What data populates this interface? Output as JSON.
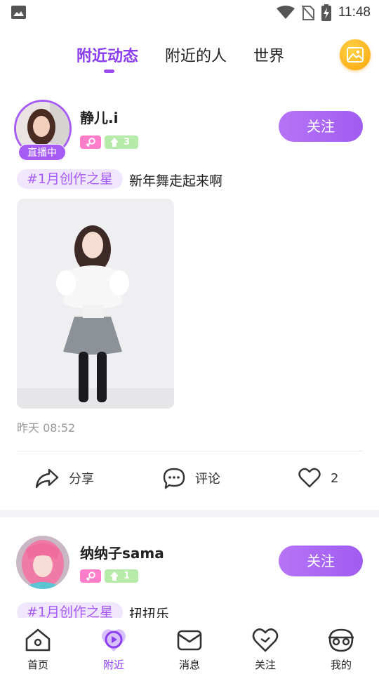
{
  "status_bar": {
    "time": "11:48",
    "icons": [
      "image-icon",
      "wifi-icon",
      "no-sim-icon",
      "battery-charging-icon"
    ]
  },
  "top_tabs": {
    "items": [
      {
        "label": "附近动态",
        "active": true
      },
      {
        "label": "附近的人",
        "active": false
      },
      {
        "label": "世界",
        "active": false
      }
    ],
    "action_icon": "gallery-icon"
  },
  "posts": [
    {
      "username": "静儿.i",
      "live_badge": "直播中",
      "gender_icon": "female-icon",
      "level": "3",
      "follow_label": "关注",
      "topic": "#1月创作之星",
      "text": "新年舞走起来啊",
      "timestamp": "昨天 08:52",
      "actions": {
        "share": "分享",
        "comment": "评论",
        "likes": "2"
      }
    },
    {
      "username": "纳纳子sama",
      "gender_icon": "female-icon",
      "level": "1",
      "follow_label": "关注",
      "topic": "#1月创作之星",
      "text": "扭扭乐"
    }
  ],
  "bottom_nav": {
    "items": [
      {
        "label": "首页",
        "icon": "home-icon",
        "active": false
      },
      {
        "label": "附近",
        "icon": "nearby-icon",
        "active": true
      },
      {
        "label": "消息",
        "icon": "message-icon",
        "active": false
      },
      {
        "label": "关注",
        "icon": "heart-icon",
        "active": false
      },
      {
        "label": "我的",
        "icon": "profile-icon",
        "active": false
      }
    ]
  },
  "colors": {
    "accent": "#8b3ef0",
    "follow_button": "#a65cf4",
    "topic_bg": "#f1e7fd",
    "female_badge": "#ff7dc9",
    "level_badge": "#b6eaa9",
    "gallery_button": "#ffb21a"
  }
}
